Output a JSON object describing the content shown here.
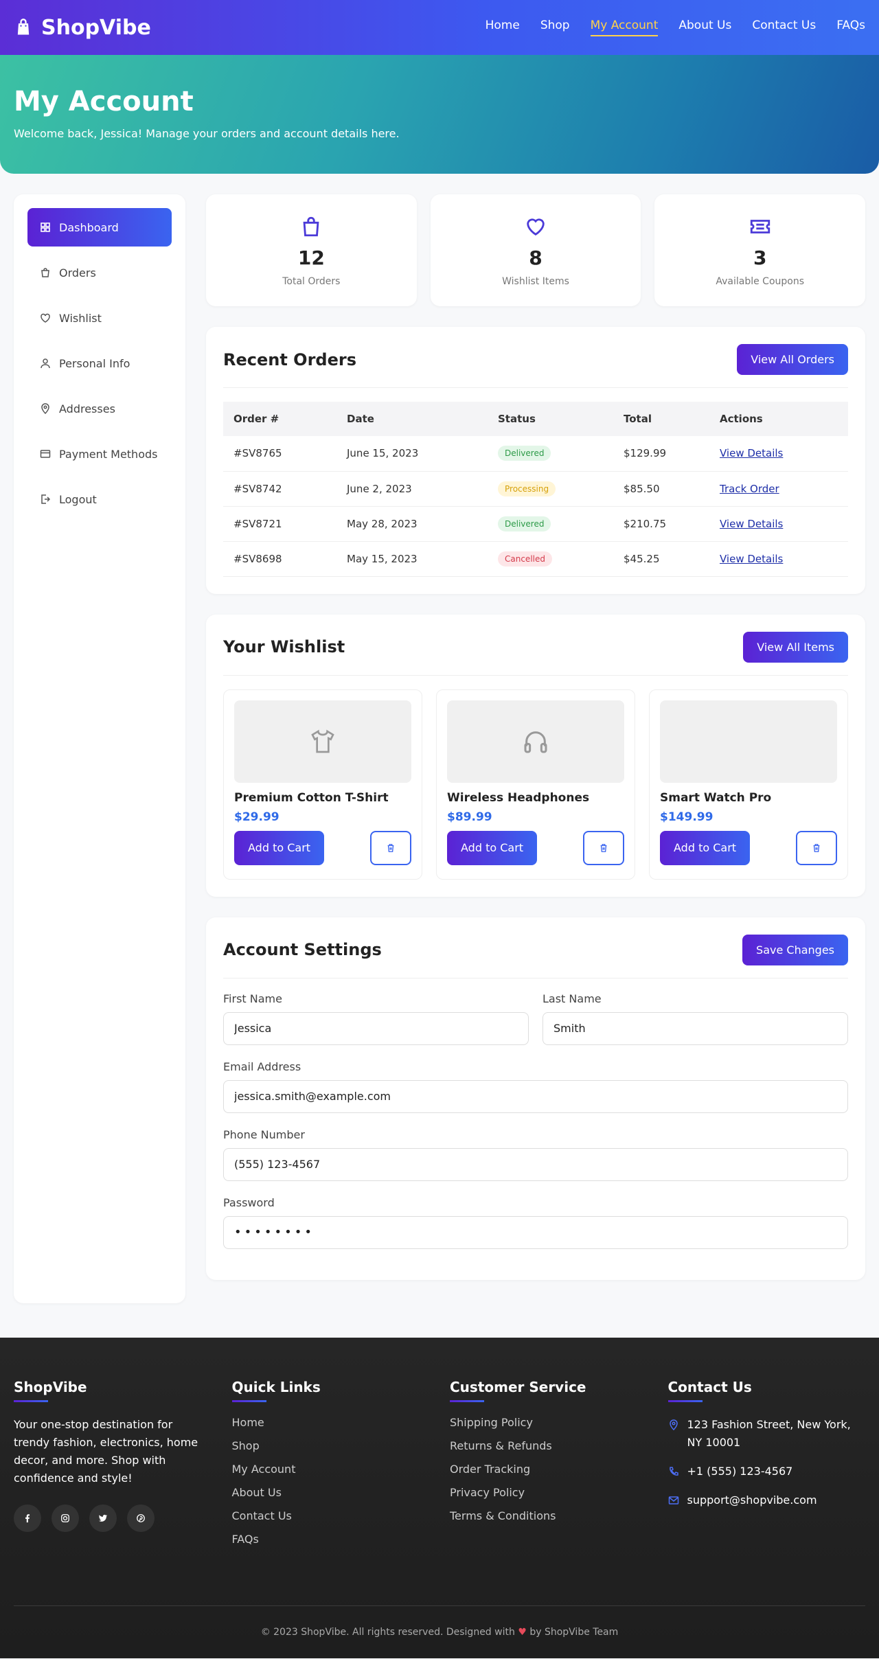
{
  "header": {
    "brand": "ShopVibe",
    "nav": [
      "Home",
      "Shop",
      "My Account",
      "About Us",
      "Contact Us",
      "FAQs"
    ],
    "active_nav": "My Account"
  },
  "hero": {
    "title": "My Account",
    "subtitle": "Welcome back, Jessica! Manage your orders and account details here."
  },
  "sidebar": {
    "items": [
      "Dashboard",
      "Orders",
      "Wishlist",
      "Personal Info",
      "Addresses",
      "Payment Methods",
      "Logout"
    ],
    "active": "Dashboard"
  },
  "stats": [
    {
      "value": "12",
      "label": "Total Orders",
      "icon": "bag-icon"
    },
    {
      "value": "8",
      "label": "Wishlist Items",
      "icon": "heart-icon"
    },
    {
      "value": "3",
      "label": "Available Coupons",
      "icon": "ticket-icon"
    }
  ],
  "orders": {
    "title": "Recent Orders",
    "view_all": "View All Orders",
    "columns": [
      "Order #",
      "Date",
      "Status",
      "Total",
      "Actions"
    ],
    "rows": [
      {
        "id": "#SV8765",
        "date": "June 15, 2023",
        "status": "Delivered",
        "total": "$129.99",
        "action": "View Details"
      },
      {
        "id": "#SV8742",
        "date": "June 2, 2023",
        "status": "Processing",
        "total": "$85.50",
        "action": "Track Order"
      },
      {
        "id": "#SV8721",
        "date": "May 28, 2023",
        "status": "Delivered",
        "total": "$210.75",
        "action": "View Details"
      },
      {
        "id": "#SV8698",
        "date": "May 15, 2023",
        "status": "Cancelled",
        "total": "$45.25",
        "action": "View Details"
      }
    ]
  },
  "wishlist": {
    "title": "Your Wishlist",
    "view_all": "View All Items",
    "add_label": "Add to Cart",
    "items": [
      {
        "name": "Premium Cotton T-Shirt",
        "price": "$29.99",
        "icon": "tshirt-icon"
      },
      {
        "name": "Wireless Headphones",
        "price": "$89.99",
        "icon": "headphones-icon"
      },
      {
        "name": "Smart Watch Pro",
        "price": "$149.99",
        "icon": ""
      }
    ]
  },
  "settings": {
    "title": "Account Settings",
    "save_label": "Save Changes",
    "first_name_label": "First Name",
    "first_name": "Jessica",
    "last_name_label": "Last Name",
    "last_name": "Smith",
    "email_label": "Email Address",
    "email": "jessica.smith@example.com",
    "phone_label": "Phone Number",
    "phone": "(555) 123-4567",
    "password_label": "Password",
    "password": "password"
  },
  "footer": {
    "brand": "ShopVibe",
    "description": "Your one-stop destination for trendy fashion, electronics, home decor, and more. Shop with confidence and style!",
    "quick_links_title": "Quick Links",
    "quick_links": [
      "Home",
      "Shop",
      "My Account",
      "About Us",
      "Contact Us",
      "FAQs"
    ],
    "service_title": "Customer Service",
    "service_links": [
      "Shipping Policy",
      "Returns & Refunds",
      "Order Tracking",
      "Privacy Policy",
      "Terms & Conditions"
    ],
    "contact_title": "Contact Us",
    "address": "123 Fashion Street, New York, NY 10001",
    "phone": "+1 (555) 123-4567",
    "email": "support@shopvibe.com",
    "copyright_pre": "© 2023 ShopVibe. All rights reserved. Designed with",
    "copyright_post": "by ShopVibe Team"
  },
  "colors": {
    "accent": "#5b22d4",
    "accent2": "#3a64f0",
    "active_nav": "#ffd24a",
    "price": "#2f6ae8"
  }
}
